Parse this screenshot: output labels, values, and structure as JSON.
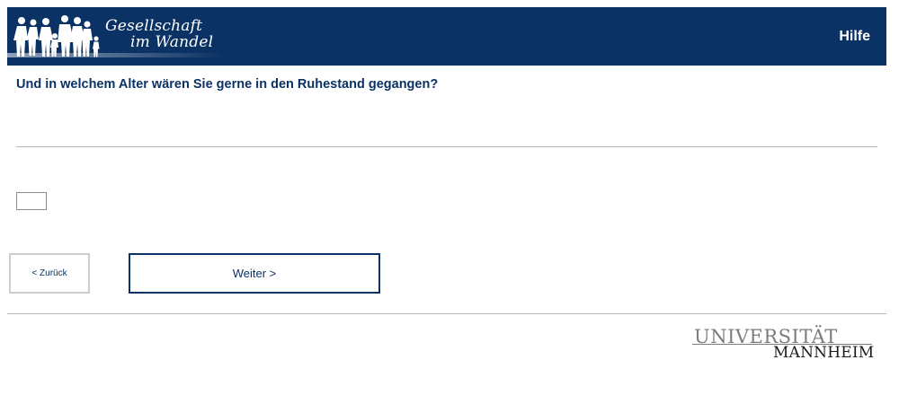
{
  "header": {
    "logo_line1": "Gesellschaft",
    "logo_line2": "im Wandel",
    "help_label": "Hilfe",
    "logo_icon": "people-silhouettes-icon",
    "background_color": "#0b3264"
  },
  "question": {
    "text": "Und in welchem Alter wären Sie gerne in den Ruhestand gegangen?",
    "input_value": ""
  },
  "navigation": {
    "back_label": "< Zurück",
    "next_label": "Weiter >"
  },
  "footer": {
    "university_line1": "UNIVERSITÄT",
    "university_line2": "MANNHEIM"
  }
}
